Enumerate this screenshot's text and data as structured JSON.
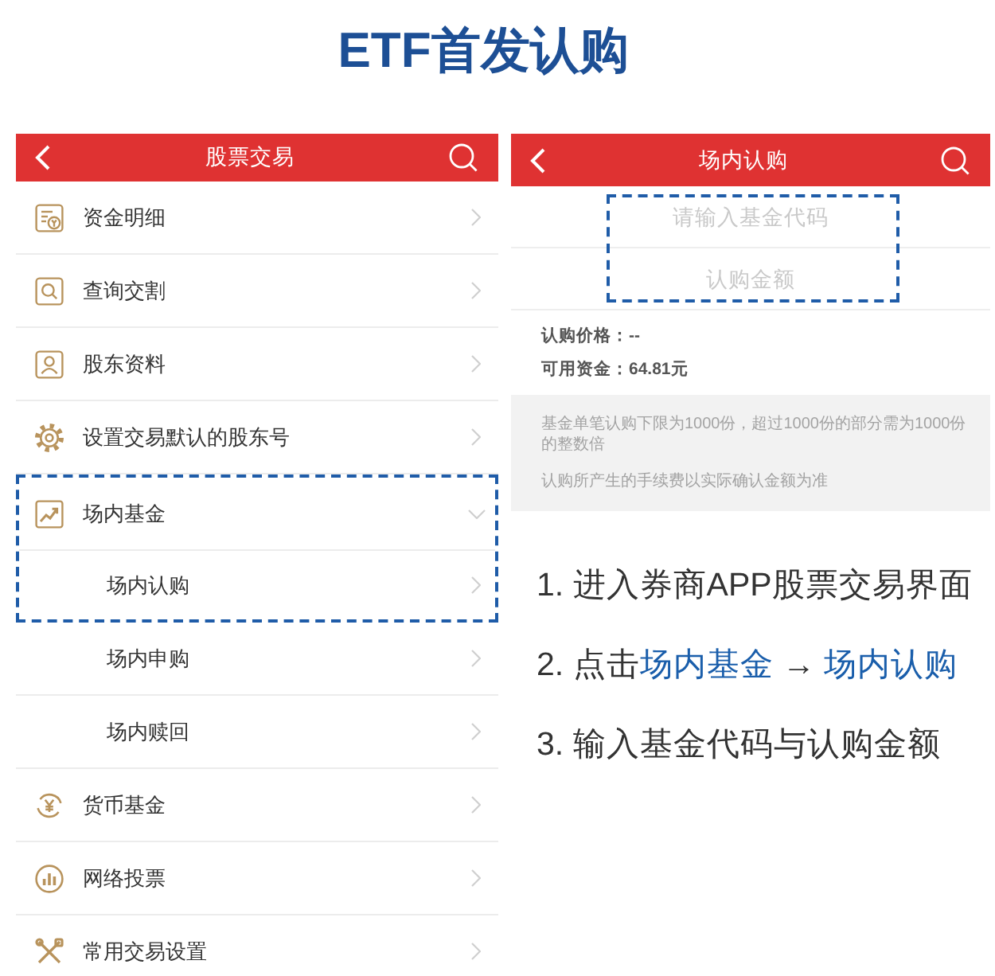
{
  "title": "ETF首发认购",
  "left_screen": {
    "header": {
      "title": "股票交易"
    },
    "items": [
      {
        "label": "资金明细",
        "kind": "link",
        "highlighted": false
      },
      {
        "label": "查询交割",
        "kind": "link",
        "highlighted": false
      },
      {
        "label": "股东资料",
        "kind": "link",
        "highlighted": false
      },
      {
        "label": "设置交易默认的股东号",
        "kind": "link",
        "highlighted": false
      },
      {
        "label": "场内基金",
        "kind": "group",
        "expanded": true,
        "highlighted": true,
        "children": [
          {
            "label": "场内认购",
            "kind": "link",
            "highlighted": true
          },
          {
            "label": "场内申购",
            "kind": "link",
            "highlighted": false
          },
          {
            "label": "场内赎回",
            "kind": "link",
            "highlighted": false
          }
        ]
      },
      {
        "label": "货币基金",
        "kind": "link",
        "highlighted": false
      },
      {
        "label": "网络投票",
        "kind": "link",
        "highlighted": false
      },
      {
        "label": "常用交易设置",
        "kind": "link",
        "highlighted": false
      }
    ]
  },
  "right_screen": {
    "header": {
      "title": "场内认购"
    },
    "form": {
      "highlighted": true,
      "fields": [
        {
          "placeholder": "请输入基金代码"
        },
        {
          "placeholder": "认购金额"
        }
      ]
    },
    "info": [
      "认购价格：--",
      "可用资金：64.81元"
    ],
    "notes": [
      "基金单笔认购下限为1000份，超过1000份的部分需为1000份的整数倍",
      "认购所产生的手续费以实际确认金额为准"
    ]
  },
  "steps": [
    {
      "segments": [
        {
          "text": "1. 进入券商APP股票交易界面",
          "highlight": false
        }
      ]
    },
    {
      "segments": [
        {
          "text": "2. 点击",
          "highlight": false
        },
        {
          "text": "场内基金",
          "highlight": true
        },
        {
          "text": " → ",
          "highlight": false
        },
        {
          "text": "场内认购",
          "highlight": true
        }
      ]
    },
    {
      "segments": [
        {
          "text": "3. 输入基金代码与认购金额",
          "highlight": false
        }
      ]
    }
  ]
}
